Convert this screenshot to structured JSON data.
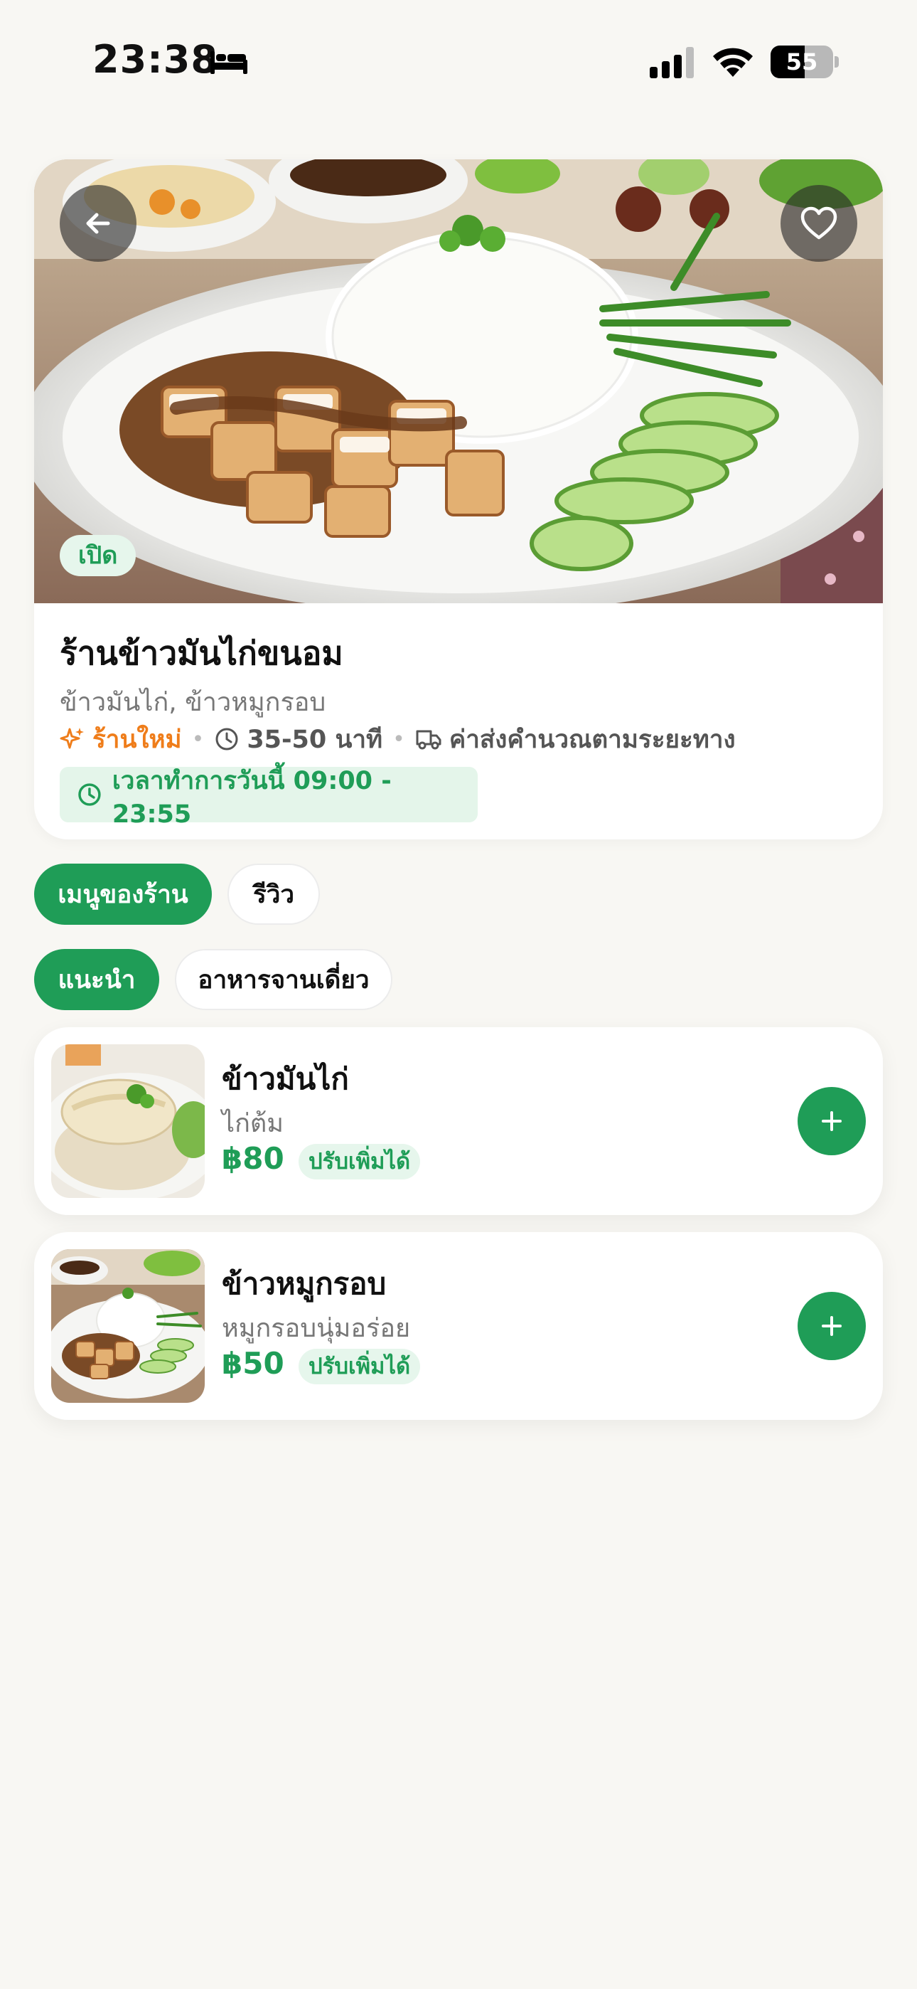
{
  "status_bar": {
    "time": "23:38",
    "focus_icon": "bed-icon",
    "battery_level": "55",
    "battery_fraction": 0.55
  },
  "store": {
    "name": "ร้านข้าวมันไก่ขนอม",
    "categories": "ข้าวมันไก่, ข้าวหมูกรอบ",
    "open_badge": "เปิด",
    "new_label": "ร้านใหม่",
    "delivery_time": "35-50 นาที",
    "delivery_fee": "ค่าส่งคำนวณตามระยะทาง",
    "hours": "เวลาทำการวันนี้ 09:00 - 23:55"
  },
  "tabs": [
    {
      "label": "เมนูของร้าน",
      "active": true
    },
    {
      "label": "รีวิว",
      "active": false
    }
  ],
  "categories": [
    {
      "label": "แนะนำ",
      "active": true
    },
    {
      "label": "อาหารจานเดี่ยว",
      "active": false
    }
  ],
  "menu": [
    {
      "name": "ข้าวมันไก่",
      "description": "ไก่ต้ม",
      "price": "฿80",
      "tag": "ปรับเพิ่มได้"
    },
    {
      "name": "ข้าวหมูกรอบ",
      "description": "หมูกรอบนุ่มอร่อย",
      "price": "฿50",
      "tag": "ปรับเพิ่มได้"
    }
  ],
  "colors": {
    "brand_green": "#1f9d57",
    "light_green": "#e6f6ec",
    "new_orange": "#ef7d1a",
    "background": "#f8f7f3"
  }
}
